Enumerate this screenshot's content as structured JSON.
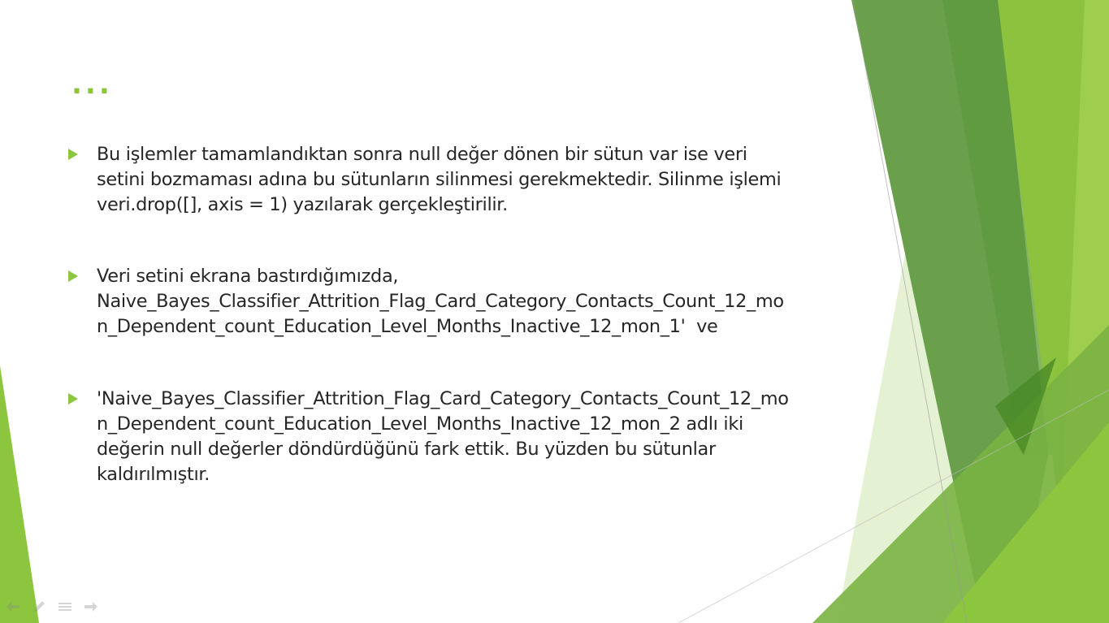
{
  "slide": {
    "title": "...",
    "bullets": [
      {
        "lines": [
          "Bu işlemler tamamlandıktan sonra null değer dönen bir sütun var ise veri",
          "setini bozmaması adına bu sütunların silinmesi gerekmektedir. Silinme işlemi",
          "veri.drop([], axis = 1) yazılarak gerçekleştirilir."
        ]
      },
      {
        "lines": [
          "Veri setini ekrana bastırdığımızda,",
          "Naive_Bayes_Classifier_Attrition_Flag_Card_Category_Contacts_Count_12_mo",
          "n_Dependent_count_Education_Level_Months_Inactive_12_mon_1'  ve"
        ]
      },
      {
        "lines": [
          "'Naive_Bayes_Classifier_Attrition_Flag_Card_Category_Contacts_Count_12_mo",
          "n_Dependent_count_Education_Level_Months_Inactive_12_mon_2 adlı iki",
          "değerin null değerler döndürdüğünü fark ettik. Bu yüzden bu sütunlar",
          "kaldırılmıştır."
        ]
      }
    ]
  },
  "colors": {
    "accent": "#8cc63f",
    "text": "#262626",
    "dark_green": "#4e8a2a",
    "mid_green": "#6fa94a",
    "light_green": "#c8e3a4"
  },
  "navigation": {
    "icons": [
      "back-arrow-icon",
      "pen-icon",
      "menu-icon",
      "forward-arrow-icon"
    ]
  }
}
